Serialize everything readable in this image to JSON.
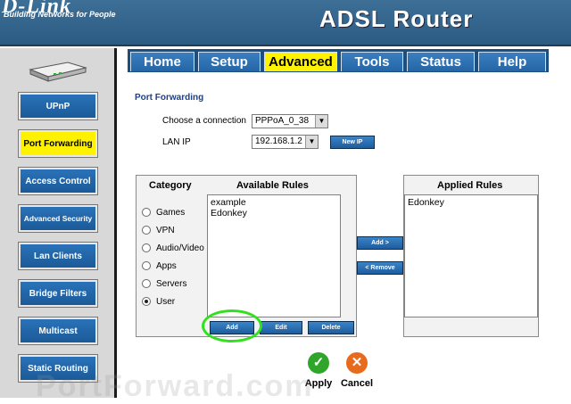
{
  "header": {
    "logo": "D-Link",
    "tagline": "Building Networks for People",
    "title": "ADSL Router"
  },
  "sidebar": {
    "items": [
      {
        "label": "UPnP"
      },
      {
        "label": "Port Forwarding",
        "active": true
      },
      {
        "label": "Access Control"
      },
      {
        "label": "Advanced Security"
      },
      {
        "label": "Lan Clients"
      },
      {
        "label": "Bridge Filters"
      },
      {
        "label": "Multicast"
      },
      {
        "label": "Static Routing"
      }
    ]
  },
  "tabs": [
    {
      "label": "Home"
    },
    {
      "label": "Setup"
    },
    {
      "label": "Advanced",
      "active": true
    },
    {
      "label": "Tools"
    },
    {
      "label": "Status"
    },
    {
      "label": "Help"
    }
  ],
  "main": {
    "section_title": "Port Forwarding",
    "connection_label": "Choose a connection",
    "connection_value": "PPPoA_0_38",
    "lan_ip_label": "LAN IP",
    "lan_ip_value": "192.168.1.2",
    "new_ip_button": "New IP",
    "category_header": "Category",
    "categories": [
      {
        "label": "Games",
        "checked": false
      },
      {
        "label": "VPN",
        "checked": false
      },
      {
        "label": "Audio/Video",
        "checked": false
      },
      {
        "label": "Apps",
        "checked": false
      },
      {
        "label": "Servers",
        "checked": false
      },
      {
        "label": "User",
        "checked": true
      }
    ],
    "available_header": "Available Rules",
    "available_rules": [
      "example",
      "Edonkey"
    ],
    "add_button": "Add",
    "edit_button": "Edit",
    "delete_button": "Delete",
    "add_to_applied_button": "Add >",
    "remove_button": "< Remove",
    "applied_header": "Applied Rules",
    "applied_rules": [
      "Edonkey"
    ],
    "apply_label": "Apply",
    "cancel_label": "Cancel"
  },
  "watermark": "PortForward.com",
  "colors": {
    "accent_blue": "#1b5a98",
    "active_yellow": "#fff200",
    "highlight_green": "#33e01f"
  }
}
